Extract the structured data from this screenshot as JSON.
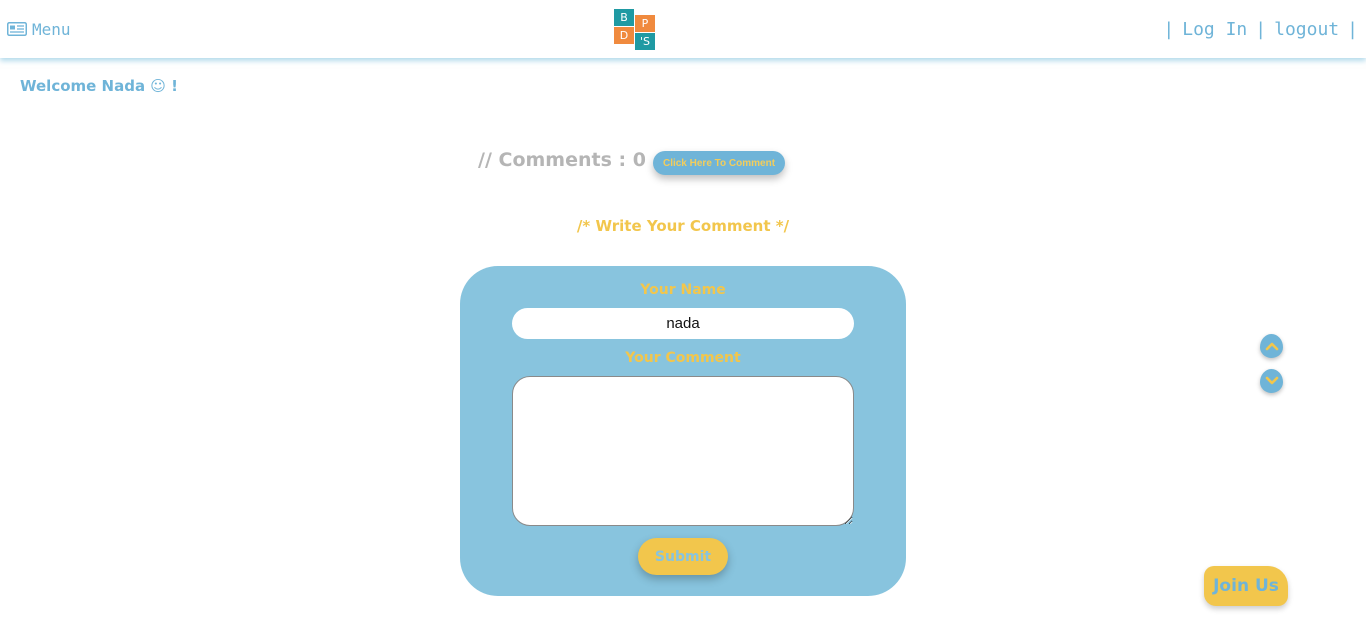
{
  "header": {
    "menu_label": "Menu",
    "menu_icon": "newspaper-icon",
    "logo_letters": [
      "B",
      "P",
      "D",
      "'S"
    ],
    "nav": {
      "sep1": "|",
      "login": "Log In",
      "sep2": "|",
      "logout": "logout",
      "sep3": "|"
    }
  },
  "welcome": {
    "text": "Welcome Nada ☺ !"
  },
  "comments": {
    "count_text": "// Comments : 0",
    "button_label": "Click Here To Comment",
    "write_title": "/* Write Your Comment */"
  },
  "form": {
    "name_label": "Your Name",
    "name_value": "nada",
    "comment_label": "Your Comment",
    "comment_value": "",
    "submit_label": "Submit"
  },
  "scroll": {
    "up_icon": "chevron-up-icon",
    "down_icon": "chevron-down-icon"
  },
  "join": {
    "label": "Join Us"
  },
  "colors": {
    "accent_blue": "#6fb4d8",
    "card_blue": "#88c4de",
    "accent_yellow": "#f2c64c",
    "logo_teal": "#1f9aa3",
    "logo_orange": "#f08a3e"
  }
}
